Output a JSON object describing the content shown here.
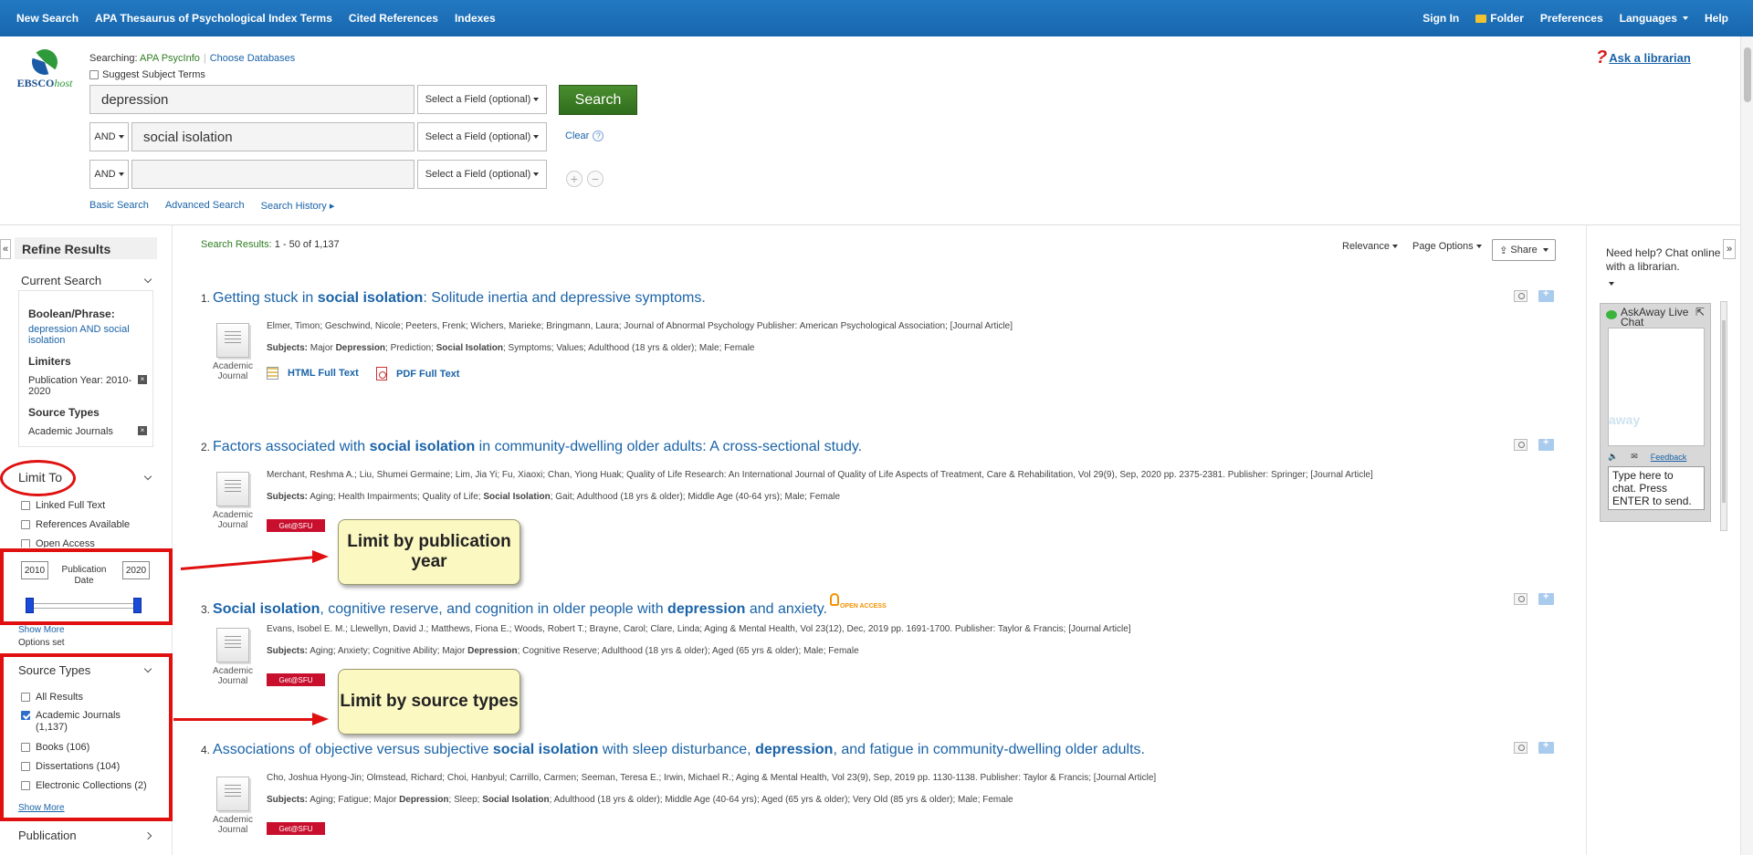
{
  "topnav": {
    "left": [
      "New Search",
      "APA Thesaurus of Psychological Index Terms",
      "Cited References",
      "Indexes"
    ],
    "right": [
      "Sign In",
      "Folder",
      "Preferences",
      "Languages",
      "Help"
    ]
  },
  "logo": {
    "brand": "EBSCO",
    "brand_suffix": "host"
  },
  "search": {
    "searching_label": "Searching:",
    "database": "APA PsycInfo",
    "choose_db": "Choose Databases",
    "suggest": "Suggest Subject Terms",
    "rows": [
      {
        "bool": "",
        "value": "depression",
        "field": "Select a Field (optional)"
      },
      {
        "bool": "AND",
        "value": "social isolation",
        "field": "Select a Field (optional)"
      },
      {
        "bool": "AND",
        "value": "",
        "field": "Select a Field (optional)"
      }
    ],
    "button": "Search",
    "clear": "Clear",
    "help": "?",
    "add": "+",
    "remove": "−",
    "links": [
      "Basic Search",
      "Advanced Search",
      "Search History"
    ]
  },
  "ask": {
    "q": "?",
    "label": "Ask a librarian"
  },
  "sidebar": {
    "collapse": "«",
    "refine": "Refine Results",
    "current_search": "Current Search",
    "boolean_label": "Boolean/Phrase:",
    "boolean_value": "depression AND social isolation",
    "limiters_label": "Limiters",
    "limiter_value": "Publication Year: 2010-2020",
    "source_types_label": "Source Types",
    "source_value": "Academic Journals",
    "remove_glyph": "×",
    "limit_to": "Limit To",
    "limit_options": [
      "Linked Full Text",
      "References Available",
      "Open Access"
    ],
    "year_from": "2010",
    "year_to": "2020",
    "pub_date": "Publication Date",
    "show_more": "Show More",
    "options_set": "Options set",
    "source_types": "Source Types",
    "source_options": [
      {
        "label": "All Results",
        "checked": false
      },
      {
        "label": "Academic Journals (1,137)",
        "checked": true
      },
      {
        "label": "Books (106)",
        "checked": false
      },
      {
        "label": "Dissertations (104)",
        "checked": false
      },
      {
        "label": "Electronic Collections (2)",
        "checked": false
      }
    ],
    "show_more_2": "Show More",
    "publication": "Publication"
  },
  "callouts": {
    "year": "Limit by publication year",
    "source": "Limit by source types"
  },
  "results": {
    "count_label": "Search Results:",
    "count_value": "1 - 50 of 1,137",
    "relevance": "Relevance",
    "page_options": "Page Options",
    "share": "Share",
    "items": [
      {
        "num": "1.",
        "title_parts": [
          "Getting stuck in ",
          "social isolation",
          ": Solitude inertia and depressive symptoms."
        ],
        "authors": "Elmer, Timon; Geschwind, Nicole; Peeters, Frenk; Wichers, Marieke; Bringmann, Laura; Journal of Abnormal Psychology Publisher: American Psychological Association; [Journal Article]",
        "subjects_label": "Subjects:",
        "subjects": [
          " Major ",
          "Depression",
          "; Prediction; ",
          "Social Isolation",
          "; Symptoms; Values; Adulthood (18 yrs & older); Male; Female"
        ],
        "type": "Academic Journal",
        "html_ft": "HTML Full Text",
        "pdf_ft": "PDF Full Text"
      },
      {
        "num": "2.",
        "title_parts": [
          "Factors associated with ",
          "social isolation",
          " in community-dwelling older adults: A cross-sectional study."
        ],
        "authors": "Merchant, Reshma A.; Liu, Shumei Germaine; Lim, Jia Yi; Fu, Xiaoxi; Chan, Yiong Huak; Quality of Life Research: An International Journal of Quality of Life Aspects of Treatment, Care & Rehabilitation, Vol 29(9), Sep, 2020 pp. 2375-2381. Publisher: Springer; [Journal Article]",
        "subjects_label": "Subjects:",
        "subjects": [
          " Aging; Health Impairments; Quality of Life; ",
          "Social Isolation",
          "; Gait; Adulthood (18 yrs & older); Middle Age (40-64 yrs); Male; Female"
        ],
        "type": "Academic Journal",
        "getit": "Get@SFU"
      },
      {
        "num": "3.",
        "title_parts": [
          "Social isolation",
          ", cognitive reserve, and cognition in older people with ",
          "depression",
          " and anxiety."
        ],
        "oa": "OPEN ACCESS",
        "authors": "Evans, Isobel E. M.; Llewellyn, David J.; Matthews, Fiona E.; Woods, Robert T.; Brayne, Carol; Clare, Linda; Aging & Mental Health, Vol 23(12), Dec, 2019 pp. 1691-1700. Publisher: Taylor & Francis; [Journal Article]",
        "subjects_label": "Subjects:",
        "subjects": [
          " Aging; Anxiety; Cognitive Ability; Major ",
          "Depression",
          "; Cognitive Reserve; Adulthood (18 yrs & older); Aged (65 yrs & older); Male; Female"
        ],
        "type": "Academic Journal",
        "getit": "Get@SFU"
      },
      {
        "num": "4.",
        "title_parts": [
          "Associations of objective versus subjective ",
          "social isolation",
          " with sleep disturbance, ",
          "depression",
          ", and fatigue in community-dwelling older adults."
        ],
        "authors": "Cho, Joshua Hyong-Jin; Olmstead, Richard; Choi, Hanbyul; Carrillo, Carmen; Seeman, Teresa E.; Irwin, Michael R.; Aging & Mental Health, Vol 23(9), Sep, 2019 pp. 1130-1138. Publisher: Taylor & Francis; [Journal Article]",
        "subjects_label": "Subjects:",
        "subjects": [
          " Aging; Fatigue; Major ",
          "Depression",
          "; Sleep; ",
          "Social Isolation",
          "; Adulthood (18 yrs & older); Middle Age (40-64 yrs); Aged (65 yrs & older); Very Old (85 yrs & older); Male; Female"
        ],
        "type": "Academic Journal",
        "getit": "Get@SFU"
      }
    ]
  },
  "chat": {
    "collapse": "»",
    "help": "Need help? Chat online with a librarian.",
    "title": "AskAway Live Chat",
    "watermark": "away",
    "feedback": "Feedback",
    "input_placeholder": "Type here to chat. Press ENTER to send."
  },
  "colors": {
    "nav": "#1f73ba",
    "search_button": "#3c7d26",
    "annotation": "#e01010",
    "callout": "#fbf8c2",
    "getit": "#c8102e"
  }
}
